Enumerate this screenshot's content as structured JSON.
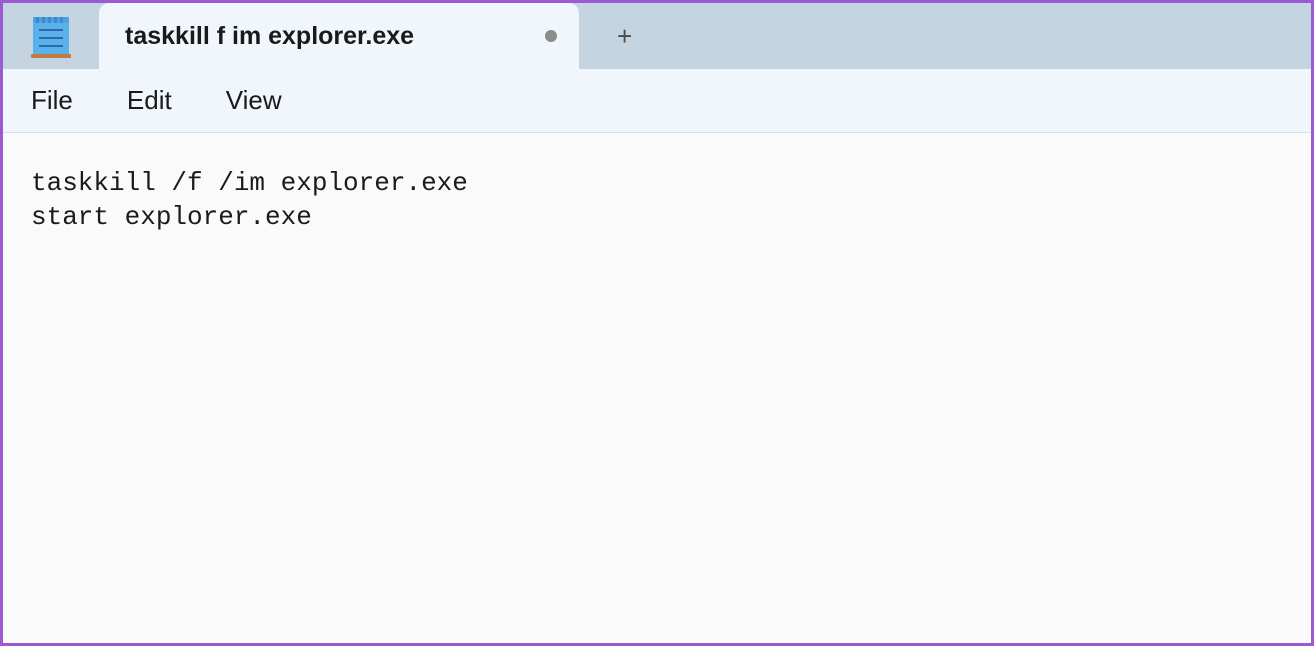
{
  "app": {
    "icon_name": "notepad-icon"
  },
  "tab": {
    "title": "taskkill f im explorer.exe",
    "modified": true
  },
  "newtab": {
    "plus": "+"
  },
  "menu": {
    "file": "File",
    "edit": "Edit",
    "view": "View"
  },
  "editor": {
    "content": "taskkill /f /im explorer.exe\nstart explorer.exe"
  }
}
